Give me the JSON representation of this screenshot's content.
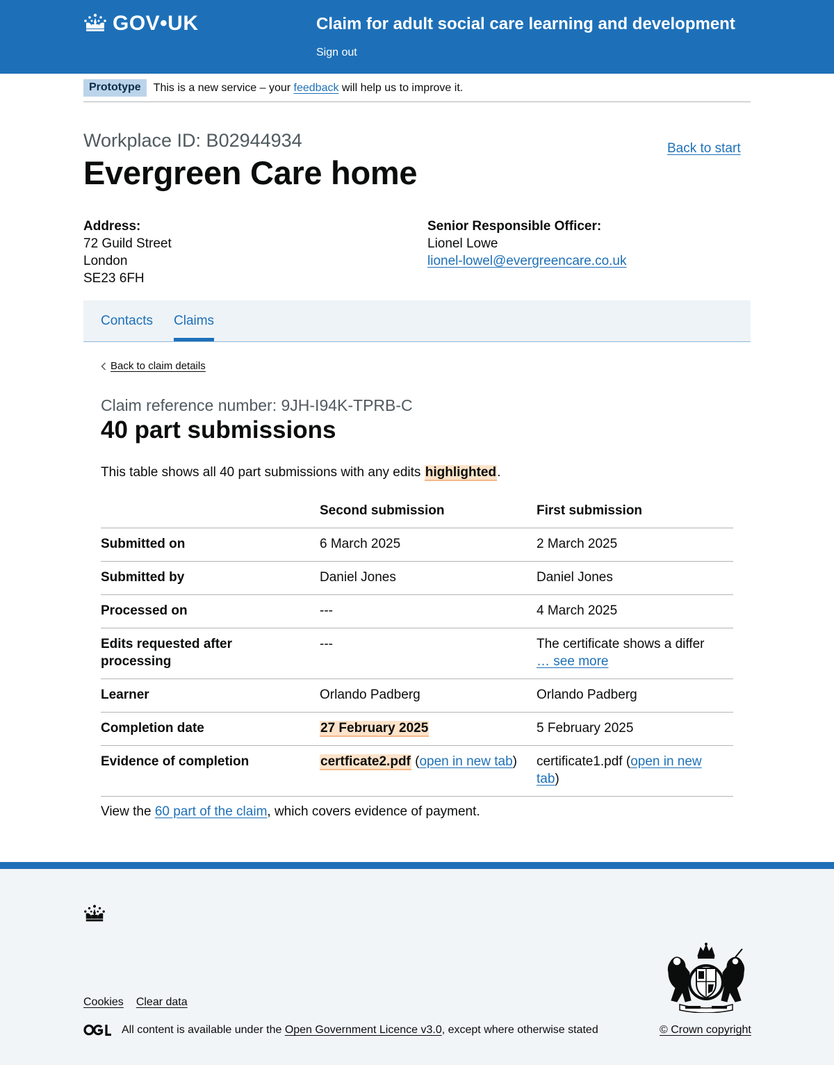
{
  "header": {
    "logo_text": "GOV•UK",
    "service_name": "Claim for adult social care learning and development",
    "sign_out": "Sign out"
  },
  "phase_banner": {
    "tag": "Prototype",
    "text_before": "This is a new service – your ",
    "link": "feedback",
    "text_after": " will help us to improve it."
  },
  "workplace": {
    "caption": "Workplace ID: B02944934",
    "title": "Evergreen Care home",
    "back_to_start": "Back to start",
    "address_label": "Address:",
    "address_lines": [
      "72 Guild Street",
      "London",
      "SE23 6FH"
    ],
    "sro_label": "Senior Responsible Officer:",
    "sro_name": "Lionel Lowe",
    "sro_email": "lionel-lowel@evergreencare.co.uk"
  },
  "tabs": [
    {
      "label": "Contacts",
      "active": false
    },
    {
      "label": "Claims",
      "active": true
    }
  ],
  "back_link": "Back to claim details",
  "claim": {
    "caption": "Claim reference number: 9JH-I94K-TPRB-C",
    "title": "40 part submissions",
    "intro_before": "This table shows all 40 part submissions with any edits ",
    "intro_highlight": "highlighted",
    "intro_after": "."
  },
  "table": {
    "headers": [
      "",
      "Second submission",
      "First submission"
    ],
    "rows": {
      "submitted_on": {
        "label": "Submitted on",
        "second": "6 March 2025",
        "first": "2 March 2025"
      },
      "submitted_by": {
        "label": "Submitted by",
        "second": "Daniel Jones",
        "first": "Daniel Jones"
      },
      "processed_on": {
        "label": "Processed on",
        "second": "---",
        "first": "4 March 2025"
      },
      "edits_requested": {
        "label": "Edits requested after processing",
        "second": "---",
        "first": "The certificate shows a differ",
        "first_link": "… see more"
      },
      "learner": {
        "label": "Learner",
        "second": "Orlando Padberg",
        "first": "Orlando Padberg"
      },
      "completion_date": {
        "label": "Completion date",
        "second": "27 February 2025",
        "first": "5 February 2025"
      },
      "evidence": {
        "label": "Evidence of completion",
        "second_file": "certficate2.pdf",
        "first_file": "certificate1.pdf",
        "open_link": "open in new tab"
      }
    }
  },
  "outro": {
    "before": "View the ",
    "link": "60 part of the claim",
    "after": ", which covers evidence of payment."
  },
  "footer": {
    "links": [
      "Cookies",
      "Clear data"
    ],
    "licence_before": "All content is available under the ",
    "licence_link": "Open Government Licence v3.0",
    "licence_after": ", except where otherwise stated",
    "copyright": "© Crown copyright"
  },
  "colors": {
    "brand": "#1d70b8",
    "highlight": "#fde3c9",
    "text": "#0b0c0c",
    "secondary_text": "#505a5f"
  }
}
